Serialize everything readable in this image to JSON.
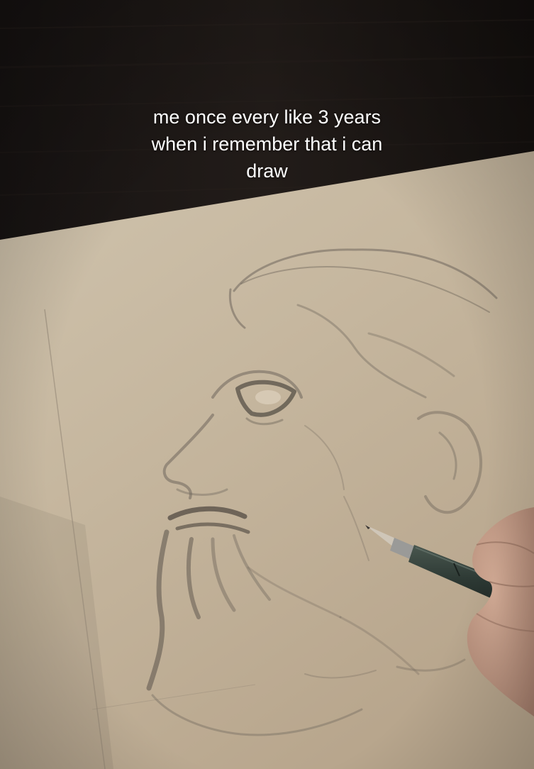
{
  "caption": {
    "line1": "me once every like 3 years",
    "line2": "when i remember that i can",
    "line3": "draw"
  },
  "colors": {
    "background_wood": "#1b1715",
    "paper": "#c9bba4",
    "pencil_sketch": "#6f665c",
    "pencil_body": "#2f3c36",
    "skin": "#c89f8a"
  },
  "icons": {
    "sketch": "bearded-face-pencil-sketch",
    "pencil": "mechanical-pencil",
    "hand": "hand"
  }
}
